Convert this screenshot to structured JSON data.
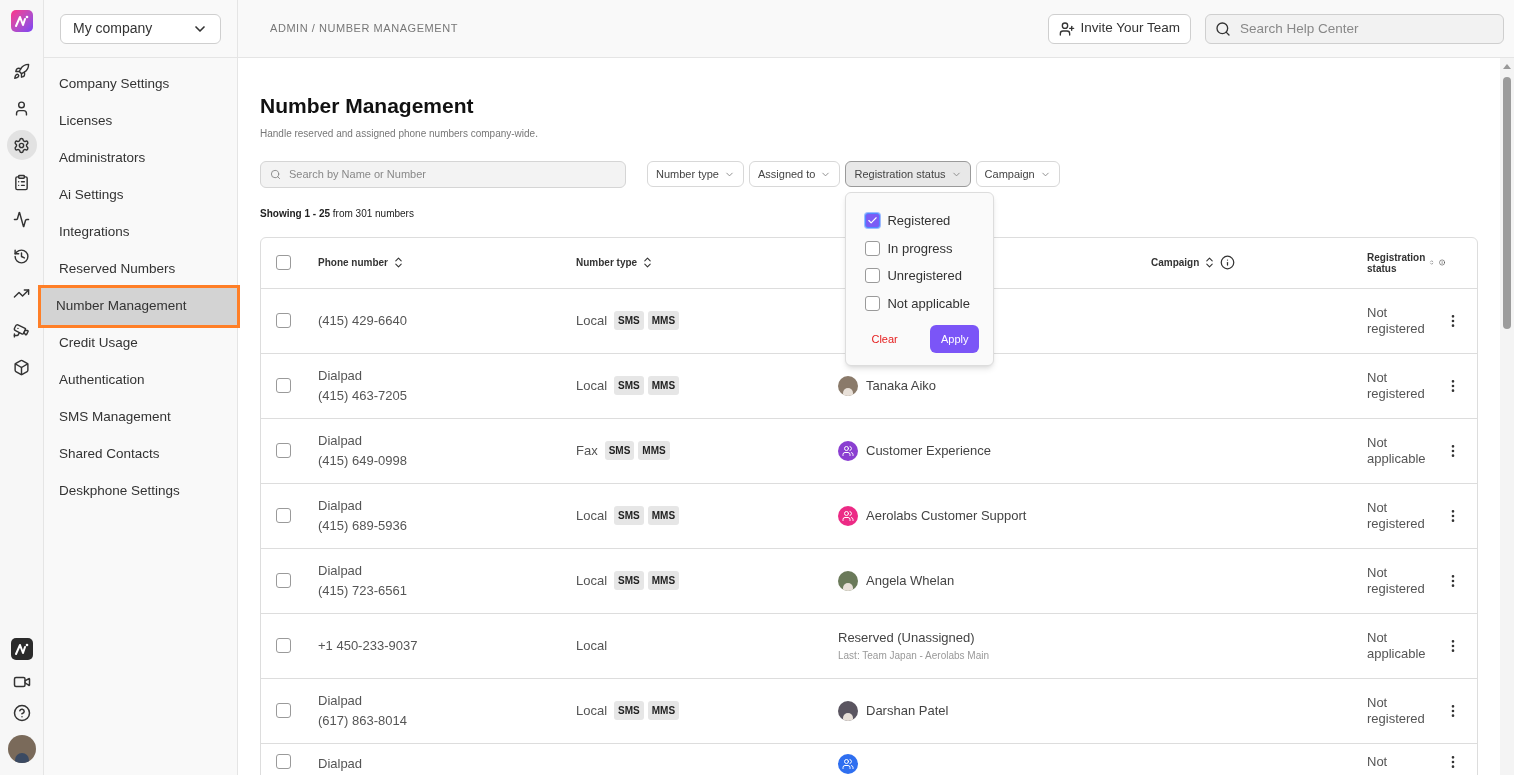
{
  "rail": {
    "items": [
      {
        "selected": false
      },
      {
        "selected": false
      },
      {
        "selected": true
      },
      {
        "selected": false
      },
      {
        "selected": false
      },
      {
        "selected": false
      },
      {
        "selected": false
      },
      {
        "selected": false
      },
      {
        "selected": false
      }
    ],
    "bottom": [
      {
        "selected": false
      },
      {
        "selected": false
      },
      {
        "selected": false
      }
    ]
  },
  "company_select": {
    "value": "My company"
  },
  "sidebar": {
    "items": [
      {
        "label": "Company Settings",
        "selected": false
      },
      {
        "label": "Licenses",
        "selected": false
      },
      {
        "label": "Administrators",
        "selected": false
      },
      {
        "label": "Ai Settings",
        "selected": false
      },
      {
        "label": "Integrations",
        "selected": false
      },
      {
        "label": "Reserved Numbers",
        "selected": false
      },
      {
        "label": "Number Management",
        "selected": true
      },
      {
        "label": "Credit Usage",
        "selected": false
      },
      {
        "label": "Authentication",
        "selected": false
      },
      {
        "label": "SMS Management",
        "selected": false
      },
      {
        "label": "Shared Contacts",
        "selected": false
      },
      {
        "label": "Deskphone Settings",
        "selected": false
      }
    ]
  },
  "breadcrumb": "ADMIN / NUMBER MANAGEMENT",
  "invite_button": "Invite Your Team",
  "help_search": {
    "placeholder": "Search Help Center"
  },
  "page": {
    "title": "Number Management",
    "subtitle": "Handle reserved and assigned phone numbers company-wide."
  },
  "search": {
    "placeholder": "Search by Name or Number"
  },
  "filters": [
    {
      "label": "Number type",
      "selected": false
    },
    {
      "label": "Assigned to",
      "selected": false
    },
    {
      "label": "Registration status",
      "selected": true
    },
    {
      "label": "Campaign",
      "selected": false
    }
  ],
  "filter_menu": {
    "options": [
      {
        "label": "Registered",
        "checked": true
      },
      {
        "label": "In progress",
        "checked": false
      },
      {
        "label": "Unregistered",
        "checked": false
      },
      {
        "label": "Not applicable",
        "checked": false
      }
    ],
    "clear": "Clear",
    "apply": "Apply"
  },
  "showing": "**Showing 1 - 25** from 301 numbers",
  "table": {
    "header_checked": false,
    "columns": [
      {
        "label": "Phone number",
        "sortable": true,
        "info": false
      },
      {
        "label": "Number type",
        "sortable": true,
        "info": false
      },
      {
        "label": "Campaign",
        "sortable": true,
        "info": true
      },
      {
        "label": "Registration status",
        "sortable": true,
        "info": true
      }
    ],
    "rows": [
      {
        "checked": false,
        "phone": "(415) 429-6640",
        "type": "Local",
        "tags": [
          "SMS",
          "MMS"
        ],
        "status": "Not registered"
      },
      {
        "checked": false,
        "line": "Dialpad",
        "phone": "(415) 463-7205",
        "type": "Local",
        "tags": [
          "SMS",
          "MMS"
        ],
        "assigned": {
          "kind": "person",
          "name": "Tanaka Aiko",
          "color": "#8a7a6a"
        },
        "status": "Not registered"
      },
      {
        "checked": false,
        "line": "Dialpad",
        "phone": "(415) 649-0998",
        "type": "Fax",
        "tags": [
          "SMS",
          "MMS"
        ],
        "assigned": {
          "kind": "team",
          "name": "Customer Experience",
          "color": "#8b3fd1"
        },
        "status": "Not applicable"
      },
      {
        "checked": false,
        "line": "Dialpad",
        "phone": "(415) 689-5936",
        "type": "Local",
        "tags": [
          "SMS",
          "MMS"
        ],
        "assigned": {
          "kind": "team",
          "name": "Aerolabs Customer Support",
          "color": "#ec2a85"
        },
        "status": "Not registered"
      },
      {
        "checked": false,
        "line": "Dialpad",
        "phone": "(415) 723-6561",
        "type": "Local",
        "tags": [
          "SMS",
          "MMS"
        ],
        "assigned": {
          "kind": "person",
          "name": "Angela Whelan",
          "color": "#6b7a5a"
        },
        "status": "Not registered"
      },
      {
        "checked": false,
        "phone": "+1 450-233-9037",
        "type": "Local",
        "tags": [],
        "assigned": {
          "kind": "reserved",
          "name": "Reserved (Unassigned)",
          "note": "Last: Team Japan - Aerolabs Main"
        },
        "status": "Not applicable"
      },
      {
        "checked": false,
        "line": "Dialpad",
        "phone": "(617) 863-8014",
        "type": "Local",
        "tags": [
          "SMS",
          "MMS"
        ],
        "assigned": {
          "kind": "person",
          "name": "Darshan Patel",
          "color": "#5a5560"
        },
        "status": "Not registered"
      },
      {
        "checked": false,
        "line": "Dialpad",
        "tags": [],
        "assigned": {
          "kind": "team",
          "color": "#2f6ff0"
        },
        "status": "Not"
      }
    ]
  }
}
